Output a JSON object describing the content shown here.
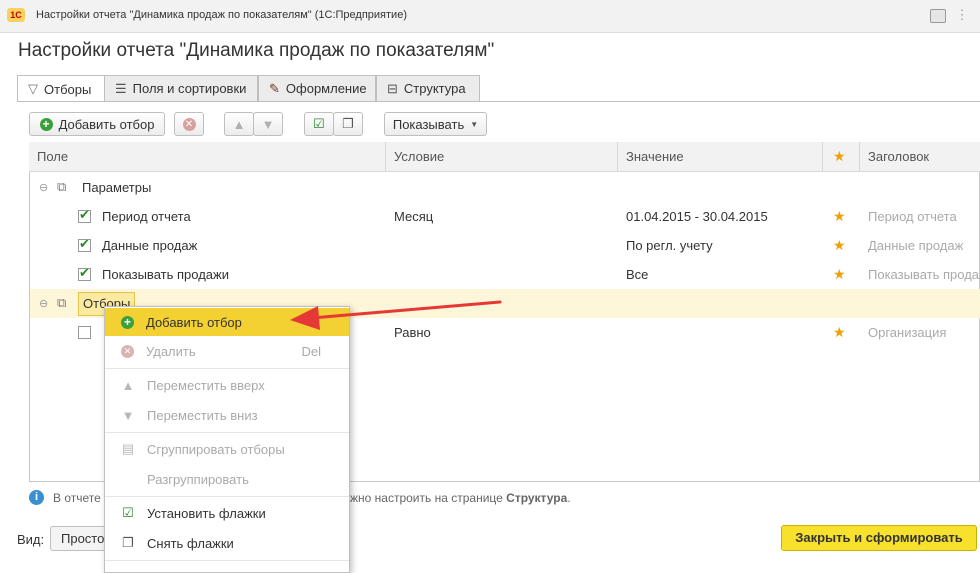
{
  "window": {
    "title": "Настройки отчета \"Динамика продаж по показателям\" (1С:Предприятие)",
    "logo_text": "1С"
  },
  "form": {
    "title": "Настройки отчета \"Динамика продаж по показателям\""
  },
  "tabs": [
    {
      "label": "Отборы",
      "icon": "filter-icon",
      "active": true
    },
    {
      "label": "Поля и сортировки",
      "icon": "fields-sort-icon",
      "active": false
    },
    {
      "label": "Оформление",
      "icon": "brush-icon",
      "active": false
    },
    {
      "label": "Структура",
      "icon": "structure-icon",
      "active": false
    }
  ],
  "toolbar": {
    "add_filter_label": "Добавить отбор",
    "show_label": "Показывать"
  },
  "table": {
    "headers": {
      "field": "Поле",
      "condition": "Условие",
      "value": "Значение",
      "star": "★",
      "caption": "Заголовок"
    },
    "groups": [
      {
        "name": "Параметры",
        "rows": [
          {
            "field": "Период отчета",
            "condition": "Месяц",
            "value": "01.04.2015 - 30.04.2015",
            "caption": "Период отчета",
            "checked": true
          },
          {
            "field": "Данные продаж",
            "condition": "",
            "value": "По регл. учету",
            "caption": "Данные продаж",
            "checked": true
          },
          {
            "field": "Показывать продажи",
            "condition": "",
            "value": "Все",
            "caption": "Показывать продаж",
            "checked": true
          }
        ]
      },
      {
        "name": "Отборы",
        "rows": [
          {
            "field": "",
            "condition": "Равно",
            "value": "",
            "caption": "Организация",
            "checked": false
          }
        ]
      }
    ]
  },
  "info": {
    "left": "В отчете",
    "right_prefix": "жно настроить на странице ",
    "right_link": "Структура",
    "right_suffix": "."
  },
  "bottom": {
    "view_label": "Вид:",
    "view_value": "Просто",
    "close_button": "Закрыть и сформировать"
  },
  "context_menu": {
    "items": [
      {
        "label": "Добавить отбор",
        "icon": "add-icon",
        "enabled": true,
        "highlighted": true,
        "shortcut": ""
      },
      {
        "label": "Удалить",
        "icon": "delete-icon",
        "enabled": false,
        "highlighted": false,
        "shortcut": "Del"
      },
      {
        "label": "Переместить вверх",
        "icon": "arrow-up-icon",
        "enabled": false,
        "highlighted": false,
        "shortcut": ""
      },
      {
        "label": "Переместить вниз",
        "icon": "arrow-down-icon",
        "enabled": false,
        "highlighted": false,
        "shortcut": ""
      },
      {
        "label": "Сгруппировать отборы",
        "icon": "group-icon",
        "enabled": false,
        "highlighted": false,
        "shortcut": ""
      },
      {
        "label": "Разгруппировать",
        "icon": "",
        "enabled": false,
        "highlighted": false,
        "shortcut": ""
      },
      {
        "label": "Установить флажки",
        "icon": "check-all-icon",
        "enabled": true,
        "highlighted": false,
        "shortcut": ""
      },
      {
        "label": "Снять флажки",
        "icon": "uncheck-all-icon",
        "enabled": true,
        "highlighted": false,
        "shortcut": ""
      }
    ]
  },
  "colors": {
    "accent_yellow": "#f7e12c",
    "highlight_row": "#fdf6d8",
    "arrow_red": "#e53935",
    "star": "#f0a000",
    "check_green": "#2a8a2a"
  }
}
